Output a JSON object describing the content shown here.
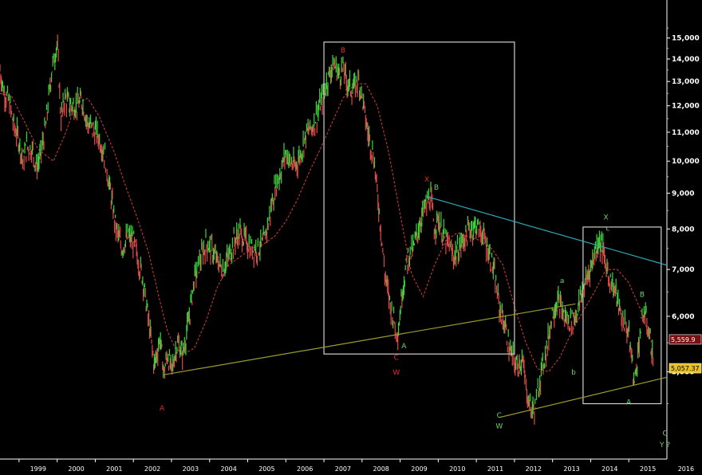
{
  "chart_data": {
    "type": "line",
    "x_axis": {
      "tick_labels": [
        "1999",
        "2000",
        "2001",
        "2002",
        "2003",
        "2004",
        "2005",
        "2006",
        "2007",
        "2008",
        "2009",
        "2010",
        "2011",
        "2012",
        "2013",
        "2014",
        "2015",
        "2016"
      ],
      "range": [
        1998.5,
        2016.0
      ]
    },
    "y_axis": {
      "scale": "log",
      "position": "right",
      "tick_labels": [
        "5,000",
        "6,000",
        "7,000",
        "8,000",
        "9,000",
        "10,000",
        "11,000",
        "12,000",
        "13,000",
        "14,000",
        "15,000"
      ],
      "tick_values": [
        5000,
        6000,
        7000,
        8000,
        9000,
        10000,
        11000,
        12000,
        13000,
        14000,
        15000
      ],
      "range": [
        3750,
        17000
      ]
    },
    "grid": false,
    "series": [
      {
        "role": "price",
        "style": "bars",
        "color_up": "#3bd43b",
        "color_down": "#e04a4a",
        "x": [
          1998.5,
          1998.6,
          1998.75,
          1998.85,
          1999.0,
          1999.1,
          1999.2,
          1999.35,
          1999.45,
          1999.55,
          1999.7,
          1999.85,
          2000.0,
          2000.1,
          2000.2,
          2000.35,
          2000.5,
          2000.65,
          2000.8,
          2000.95,
          2001.1,
          2001.25,
          2001.4,
          2001.55,
          2001.7,
          2001.85,
          2002.0,
          2002.1,
          2002.25,
          2002.4,
          2002.55,
          2002.7,
          2002.8,
          2002.9,
          2003.0,
          2003.15,
          2003.3,
          2003.45,
          2003.6,
          2003.75,
          2003.9,
          2004.05,
          2004.2,
          2004.35,
          2004.5,
          2004.65,
          2004.8,
          2004.95,
          2005.1,
          2005.25,
          2005.4,
          2005.55,
          2005.7,
          2005.85,
          2006.0,
          2006.1,
          2006.25,
          2006.4,
          2006.55,
          2006.7,
          2006.85,
          2007.0,
          2007.1,
          2007.25,
          2007.4,
          2007.5,
          2007.6,
          2007.75,
          2007.9,
          2008.0,
          2008.15,
          2008.3,
          2008.45,
          2008.6,
          2008.75,
          2008.85,
          2008.95,
          2009.05,
          2009.2,
          2009.35,
          2009.5,
          2009.65,
          2009.8,
          2009.9,
          2010.0,
          2010.1,
          2010.25,
          2010.4,
          2010.55,
          2010.7,
          2010.85,
          2011.0,
          2011.15,
          2011.3,
          2011.45,
          2011.6,
          2011.75,
          2011.9,
          2012.05,
          2012.2,
          2012.35,
          2012.45,
          2012.55,
          2012.7,
          2012.85,
          2013.0,
          2013.15,
          2013.3,
          2013.45,
          2013.6,
          2013.75,
          2013.9,
          2014.05,
          2014.2,
          2014.3,
          2014.4,
          2014.5,
          2014.65,
          2014.8,
          2014.95,
          2015.05,
          2015.15,
          2015.3,
          2015.4,
          2015.5,
          2015.6,
          2015.65
        ],
        "values": [
          13500,
          12600,
          12100,
          11300,
          10700,
          10000,
          10500,
          10400,
          9800,
          10100,
          11200,
          13400,
          14800,
          11500,
          12300,
          12000,
          12000,
          12200,
          11300,
          11100,
          10800,
          10200,
          9000,
          8000,
          7500,
          7800,
          7700,
          7300,
          6800,
          5900,
          5100,
          5600,
          4980,
          5300,
          5000,
          5500,
          5300,
          5900,
          6800,
          7200,
          7600,
          7500,
          7200,
          7000,
          7300,
          7700,
          7900,
          7700,
          7500,
          7500,
          7600,
          8200,
          9100,
          9600,
          10300,
          10000,
          9800,
          10300,
          11000,
          11200,
          11800,
          12500,
          13100,
          13800,
          13300,
          13600,
          13000,
          12600,
          13100,
          12400,
          11000,
          10200,
          8500,
          6900,
          6200,
          5900,
          5700,
          6500,
          7300,
          7500,
          8100,
          8600,
          8900,
          8000,
          8300,
          7900,
          7600,
          7300,
          7500,
          7800,
          8000,
          8100,
          7900,
          7500,
          7000,
          6200,
          5800,
          5300,
          5100,
          5200,
          4600,
          4400,
          4450,
          5000,
          5400,
          6100,
          6300,
          6000,
          5900,
          6000,
          6400,
          6800,
          7200,
          7700,
          7550,
          7100,
          6800,
          6500,
          6000,
          5800,
          5400,
          4800,
          5700,
          6100,
          5800,
          5400,
          5057
        ]
      },
      {
        "role": "moving average",
        "style": "dashed",
        "color": "#c03a3a",
        "x": [
          1998.5,
          1998.8,
          1999.1,
          1999.5,
          1999.9,
          2000.2,
          2000.5,
          2000.8,
          2001.1,
          2001.5,
          2001.8,
          2002.1,
          2002.4,
          2002.7,
          2002.9,
          2003.1,
          2003.3,
          2003.6,
          2003.9,
          2004.2,
          2004.5,
          2004.8,
          2005.1,
          2005.4,
          2005.7,
          2006.0,
          2006.3,
          2006.6,
          2006.9,
          2007.2,
          2007.5,
          2007.8,
          2008.1,
          2008.4,
          2008.7,
          2009.0,
          2009.3,
          2009.6,
          2009.9,
          2010.2,
          2010.5,
          2010.8,
          2011.1,
          2011.4,
          2011.7,
          2012.0,
          2012.3,
          2012.6,
          2012.9,
          2013.2,
          2013.5,
          2013.8,
          2014.1,
          2014.4,
          2014.7,
          2015.0,
          2015.3,
          2015.6
        ],
        "values": [
          12500,
          12400,
          11500,
          10400,
          10000,
          10900,
          12100,
          12300,
          11600,
          10300,
          9200,
          8300,
          7400,
          6300,
          5700,
          5400,
          5300,
          5400,
          5900,
          6600,
          7100,
          7300,
          7500,
          7600,
          7800,
          8200,
          8800,
          9600,
          10400,
          11300,
          12300,
          12900,
          12900,
          12000,
          10300,
          8400,
          6900,
          6400,
          7100,
          7700,
          7900,
          7800,
          7700,
          7500,
          7100,
          6200,
          5500,
          5050,
          5000,
          5250,
          5700,
          6100,
          6500,
          7000,
          7000,
          6700,
          6150,
          5500
        ]
      }
    ],
    "price_tags": [
      {
        "text": "5,559.9",
        "value": 5560,
        "color": "#7a1010"
      },
      {
        "text": "5,057.37",
        "value": 5057,
        "color": "#e8c020"
      }
    ],
    "annotations": {
      "wave_labels": [
        {
          "text": "A",
          "x": 2002.75,
          "value": 4400,
          "color": "#e03030"
        },
        {
          "text": "B",
          "x": 2007.5,
          "value": 14300,
          "color": "#e03030"
        },
        {
          "text": "X",
          "x": 2009.7,
          "value": 9350,
          "color": "#e03030"
        },
        {
          "text": "B",
          "x": 2009.95,
          "value": 9100,
          "color": "#6cd36c"
        },
        {
          "text": "A",
          "x": 2009.1,
          "value": 5400,
          "color": "#6cd36c"
        },
        {
          "text": "C",
          "x": 2008.9,
          "value": 5200,
          "color": "#e03030"
        },
        {
          "text": "W",
          "x": 2008.9,
          "value": 4950,
          "color": "#e03030"
        },
        {
          "text": "a",
          "x": 2013.25,
          "value": 6700,
          "color": "#6cd36c"
        },
        {
          "text": "b",
          "x": 2013.55,
          "value": 4950,
          "color": "#6cd36c"
        },
        {
          "text": "X",
          "x": 2014.4,
          "value": 8250,
          "color": "#6cd36c"
        },
        {
          "text": "c",
          "x": 2014.45,
          "value": 7950,
          "color": "#6cd36c"
        },
        {
          "text": "B",
          "x": 2015.35,
          "value": 6400,
          "color": "#6cd36c"
        },
        {
          "text": "A",
          "x": 2015.0,
          "value": 4490,
          "color": "#6cd36c"
        },
        {
          "text": "C",
          "x": 2011.6,
          "value": 4300,
          "color": "#6cd36c"
        },
        {
          "text": "W",
          "x": 2011.6,
          "value": 4150,
          "color": "#6cd36c"
        },
        {
          "text": "C",
          "x": 2015.95,
          "value": 4050,
          "color": "#6cd36c"
        },
        {
          "text": "Y ?",
          "x": 2015.95,
          "value": 3900,
          "color": "#6cd36c"
        }
      ],
      "trendlines": [
        {
          "x": [
            2002.8,
            2013.6
          ],
          "values": [
            4950,
            6250
          ],
          "color": "#9c9c30"
        },
        {
          "x": [
            2011.6,
            2016.0
          ],
          "values": [
            4300,
            4910
          ],
          "color": "#9c9c30"
        },
        {
          "x": [
            2009.7,
            2016.0
          ],
          "values": [
            8900,
            7100
          ],
          "color": "#2fa8b5"
        }
      ],
      "boxes": [
        {
          "x": [
            2007.0,
            2012.0
          ],
          "values": [
            5300,
            14800
          ],
          "color": "#d0d0d0"
        },
        {
          "x": [
            2013.8,
            2015.85
          ],
          "values": [
            4500,
            8050
          ],
          "color": "#d0d0d0"
        }
      ]
    }
  }
}
